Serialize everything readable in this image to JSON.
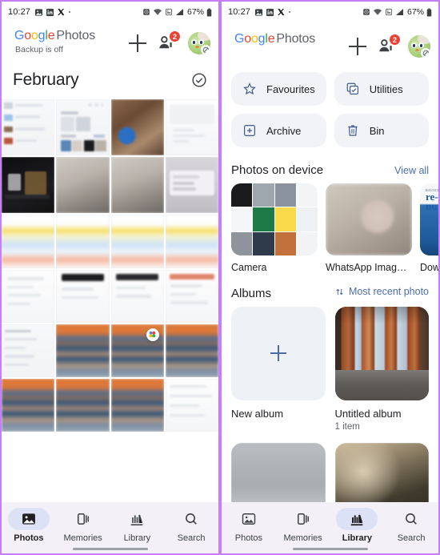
{
  "status_bar": {
    "time": "10:27",
    "left_icons": [
      "photos-icon",
      "linkedin-icon",
      "x-icon",
      "dot-icon"
    ],
    "right_icons": [
      "alarm-icon",
      "wifi-icon",
      "sim-icon",
      "signal-icon"
    ],
    "battery": "67%"
  },
  "brand": {
    "g1": "G",
    "o1": "o",
    "o2": "o",
    "g2": "g",
    "l": "l",
    "e": "e",
    "product": "Photos",
    "backup_status": "Backup is off"
  },
  "header_actions": {
    "add_label": "add-icon",
    "sharing_label": "sharing-icon",
    "sharing_badge": "2",
    "avatar_label": "account-avatar"
  },
  "left_panel": {
    "month_header": "February",
    "select_icon": "check-circle-icon",
    "grid_rows": [
      [
        {
          "kind": "screenshot-list",
          "name": "photo-thumbnail-screenshot-list"
        },
        {
          "kind": "screenshot-settings",
          "name": "photo-thumbnail-screenshot-settings"
        },
        {
          "kind": "tools",
          "name": "photo-thumbnail-tools"
        },
        {
          "kind": "screenshot-white",
          "name": "photo-thumbnail-screenshot-white"
        }
      ],
      [
        {
          "kind": "dark-product",
          "name": "photo-thumbnail-dark-product"
        },
        {
          "kind": "pipe",
          "name": "photo-thumbnail-pipe-1"
        },
        {
          "kind": "pipe",
          "name": "photo-thumbnail-pipe-2"
        },
        {
          "kind": "dialog",
          "name": "photo-thumbnail-dialog"
        }
      ],
      [
        {
          "kind": "colorful",
          "name": "photo-thumbnail-colorful-1"
        },
        {
          "kind": "colorful",
          "name": "photo-thumbnail-colorful-2"
        },
        {
          "kind": "colorful",
          "name": "photo-thumbnail-colorful-3"
        },
        {
          "kind": "colorful",
          "name": "photo-thumbnail-colorful-4"
        }
      ],
      [
        {
          "kind": "screenshot-white",
          "name": "photo-thumbnail-screenshot-white-2"
        },
        {
          "kind": "screenshot-white",
          "name": "photo-thumbnail-screenshot-white-3"
        },
        {
          "kind": "screenshot-white",
          "name": "photo-thumbnail-screenshot-white-4"
        },
        {
          "kind": "screenshot-white",
          "name": "photo-thumbnail-screenshot-white-5"
        }
      ],
      [
        {
          "kind": "screenshot-list",
          "name": "photo-thumbnail-screenshot-list-2"
        },
        {
          "kind": "sunset",
          "name": "photo-thumbnail-sunset-1"
        },
        {
          "kind": "sunset-badge",
          "name": "photo-thumbnail-sunset-2"
        },
        {
          "kind": "sunset",
          "name": "photo-thumbnail-sunset-3"
        }
      ],
      [
        {
          "kind": "sunset",
          "name": "photo-thumbnail-sunset-4"
        },
        {
          "kind": "sunset",
          "name": "photo-thumbnail-sunset-5"
        },
        {
          "kind": "sunset",
          "name": "photo-thumbnail-sunset-6"
        },
        {
          "kind": "screenshot-white",
          "name": "photo-thumbnail-screenshot-white-6"
        }
      ]
    ]
  },
  "right_panel": {
    "chips": [
      {
        "label": "Favourites",
        "icon": "star-icon"
      },
      {
        "label": "Utilities",
        "icon": "utilities-icon"
      },
      {
        "label": "Archive",
        "icon": "archive-icon"
      },
      {
        "label": "Bin",
        "icon": "trash-icon"
      }
    ],
    "device_section": {
      "title": "Photos on device",
      "action": "View all",
      "folders": [
        {
          "label": "Camera",
          "thumb": "collage"
        },
        {
          "label": "WhatsApp Imag…",
          "thumb": "person"
        },
        {
          "label": "Downloa",
          "thumb": "renu"
        }
      ]
    },
    "albums_section": {
      "title": "Albums",
      "sort_label": "Most recent photo",
      "sort_icon": "sort-icon",
      "albums": [
        {
          "label": "New album",
          "sub": "",
          "thumb": "new"
        },
        {
          "label": "Untitled album",
          "sub": "1 item",
          "thumb": "window"
        }
      ],
      "next_row": [
        {
          "thumb": "rain",
          "name": "album-thumbnail-rain"
        },
        {
          "thumb": "trees",
          "name": "album-thumbnail-trees"
        }
      ]
    }
  },
  "bottom_nav": {
    "items": [
      {
        "label": "Photos",
        "icon": "photos-icon"
      },
      {
        "label": "Memories",
        "icon": "memories-icon"
      },
      {
        "label": "Library",
        "icon": "library-icon"
      },
      {
        "label": "Search",
        "icon": "search-icon"
      }
    ],
    "left_active": "Photos",
    "right_active": "Library"
  },
  "colors": {
    "accent_blue": "#4285F4",
    "badge_red": "#EA4335",
    "chip_bg": "#f1f3f6",
    "nav_bg": "#f3f1f7",
    "active_pill": "#dde1f5",
    "link_blue": "#4b6ea9",
    "frame_purple": "#c77dff"
  }
}
